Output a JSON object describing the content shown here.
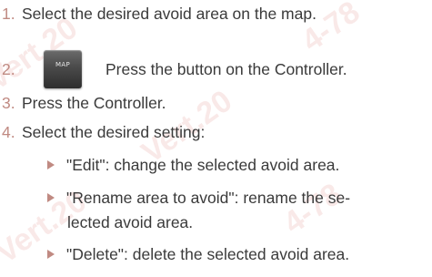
{
  "steps": [
    {
      "number": "1.",
      "text": "Select the desired avoid area on the map."
    },
    {
      "number": "2.",
      "button_label": "MAP",
      "text": "Press the button on the Controller."
    },
    {
      "number": "3.",
      "text": "Press the Controller."
    },
    {
      "number": "4.",
      "text": "Select the desired setting:"
    }
  ],
  "options": [
    {
      "text": "\"Edit\": change the selected avoid area."
    },
    {
      "text_line1": "\"Rename area to avoid\": rename the se-",
      "text_line2": "lected avoid area."
    },
    {
      "text": "\"Delete\": delete the selected avoid area."
    }
  ],
  "colors": {
    "number_accent": "#c08a82",
    "body_text": "#3a3a3a",
    "button_dark": "#3a3a3a"
  },
  "icons": {
    "map_button": "map-button-icon",
    "bullet": "triangle-bullet-icon"
  }
}
